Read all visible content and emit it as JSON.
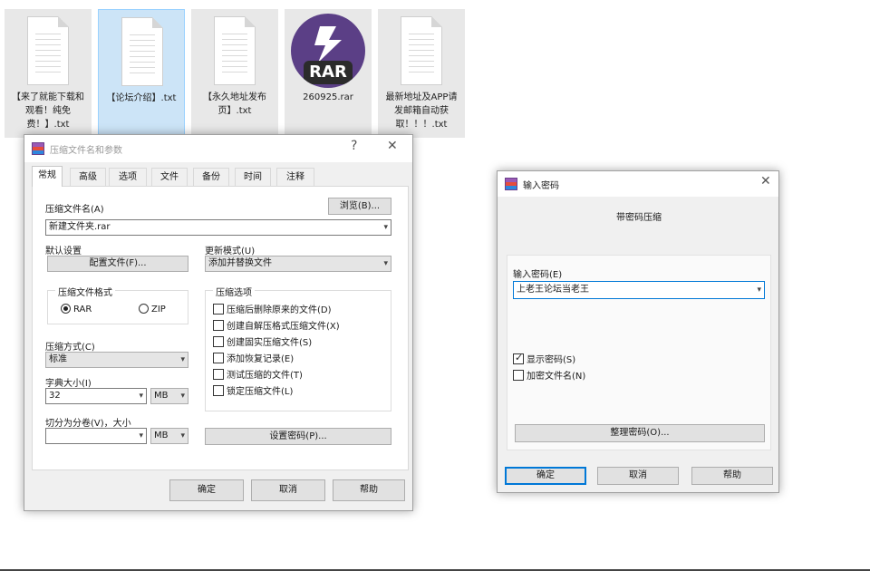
{
  "files": [
    {
      "name": "【来了就能下载和观看！纯免费！】.txt",
      "type": "txt",
      "selected": false
    },
    {
      "name": "【论坛介绍】.txt",
      "type": "txt",
      "selected": true
    },
    {
      "name": "【永久地址发布页】.txt",
      "type": "txt",
      "selected": false
    },
    {
      "name": "260925.rar",
      "type": "rar",
      "selected": false,
      "badge": "RAR"
    },
    {
      "name": "最新地址及APP请发邮箱自动获取！！！.txt",
      "type": "txt",
      "selected": false
    }
  ],
  "archive_dialog": {
    "title": "压缩文件名和参数",
    "help_glyph": "?",
    "close_glyph": "✕",
    "tabs": [
      "常规",
      "高级",
      "选项",
      "文件",
      "备份",
      "时间",
      "注释"
    ],
    "active_tab": 0,
    "archive_name_label": "压缩文件名(A)",
    "browse_button": "浏览(B)...",
    "archive_name_value": "新建文件夹.rar",
    "default_settings_label": "默认设置",
    "profiles_button": "配置文件(F)...",
    "update_mode_label": "更新模式(U)",
    "update_mode_value": "添加并替换文件",
    "format_group_label": "压缩文件格式",
    "format_options": [
      "RAR",
      "ZIP"
    ],
    "format_selected": "RAR",
    "options_group_label": "压缩选项",
    "options": [
      {
        "label": "压缩后删除原来的文件(D)",
        "checked": false
      },
      {
        "label": "创建自解压格式压缩文件(X)",
        "checked": false
      },
      {
        "label": "创建固实压缩文件(S)",
        "checked": false
      },
      {
        "label": "添加恢复记录(E)",
        "checked": false
      },
      {
        "label": "测试压缩的文件(T)",
        "checked": false
      },
      {
        "label": "锁定压缩文件(L)",
        "checked": false
      }
    ],
    "method_label": "压缩方式(C)",
    "method_value": "标准",
    "dict_size_label": "字典大小(I)",
    "dict_size_value": "32",
    "dict_size_unit": "MB",
    "split_label": "切分为分卷(V)，大小",
    "split_value": "",
    "split_unit": "MB",
    "set_password_button": "设置密码(P)...",
    "ok_button": "确定",
    "cancel_button": "取消",
    "help_button": "帮助"
  },
  "password_dialog": {
    "title": "输入密码",
    "close_glyph": "✕",
    "heading": "带密码压缩",
    "password_label": "输入密码(E)",
    "password_value": "上老王论坛当老王",
    "show_password_label": "显示密码(S)",
    "show_password_checked": true,
    "encrypt_names_label": "加密文件名(N)",
    "encrypt_names_checked": false,
    "organize_button": "整理密码(O)...",
    "ok_button": "确定",
    "cancel_button": "取消",
    "help_button": "帮助"
  }
}
